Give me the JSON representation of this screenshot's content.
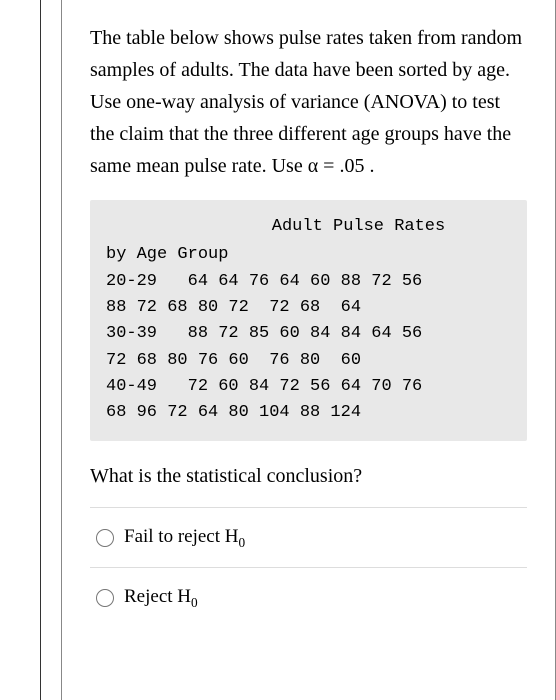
{
  "question": {
    "text": "The table below shows pulse rates taken from random samples of adults. The data have been sorted by age. Use one-way analysis of variance (ANOVA) to test the claim that the three different age groups have the same mean pulse rate. Use α = .05 ."
  },
  "data_box": {
    "title": "Adult Pulse Rates",
    "subtitle": "by Age Group",
    "rows": [
      "20-29   64 64 76 64 60 88 72 56",
      "88 72 68 80 72  72 68  64",
      "30-39   88 72 85 60 84 84 64 56",
      "72 68 80 76 60  76 80  60",
      "40-49   72 60 84 72 56 64 70 76",
      "68 96 72 64 80 104 88 124"
    ]
  },
  "conclusion_prompt": "What is the statistical conclusion?",
  "options": {
    "a": "Fail to reject H",
    "a_sub": "0",
    "b": "Reject H",
    "b_sub": "0"
  },
  "chart_data": {
    "type": "table",
    "title": "Adult Pulse Rates by Age Group",
    "alpha": 0.05,
    "series": [
      {
        "name": "20-29",
        "values": [
          64,
          64,
          76,
          64,
          60,
          88,
          72,
          56,
          88,
          72,
          68,
          80,
          72,
          72,
          68,
          64
        ]
      },
      {
        "name": "30-39",
        "values": [
          88,
          72,
          85,
          60,
          84,
          84,
          64,
          56,
          72,
          68,
          80,
          76,
          60,
          76,
          80,
          60
        ]
      },
      {
        "name": "40-49",
        "values": [
          72,
          60,
          84,
          72,
          56,
          64,
          70,
          76,
          68,
          96,
          72,
          64,
          80,
          104,
          88,
          124
        ]
      }
    ]
  }
}
